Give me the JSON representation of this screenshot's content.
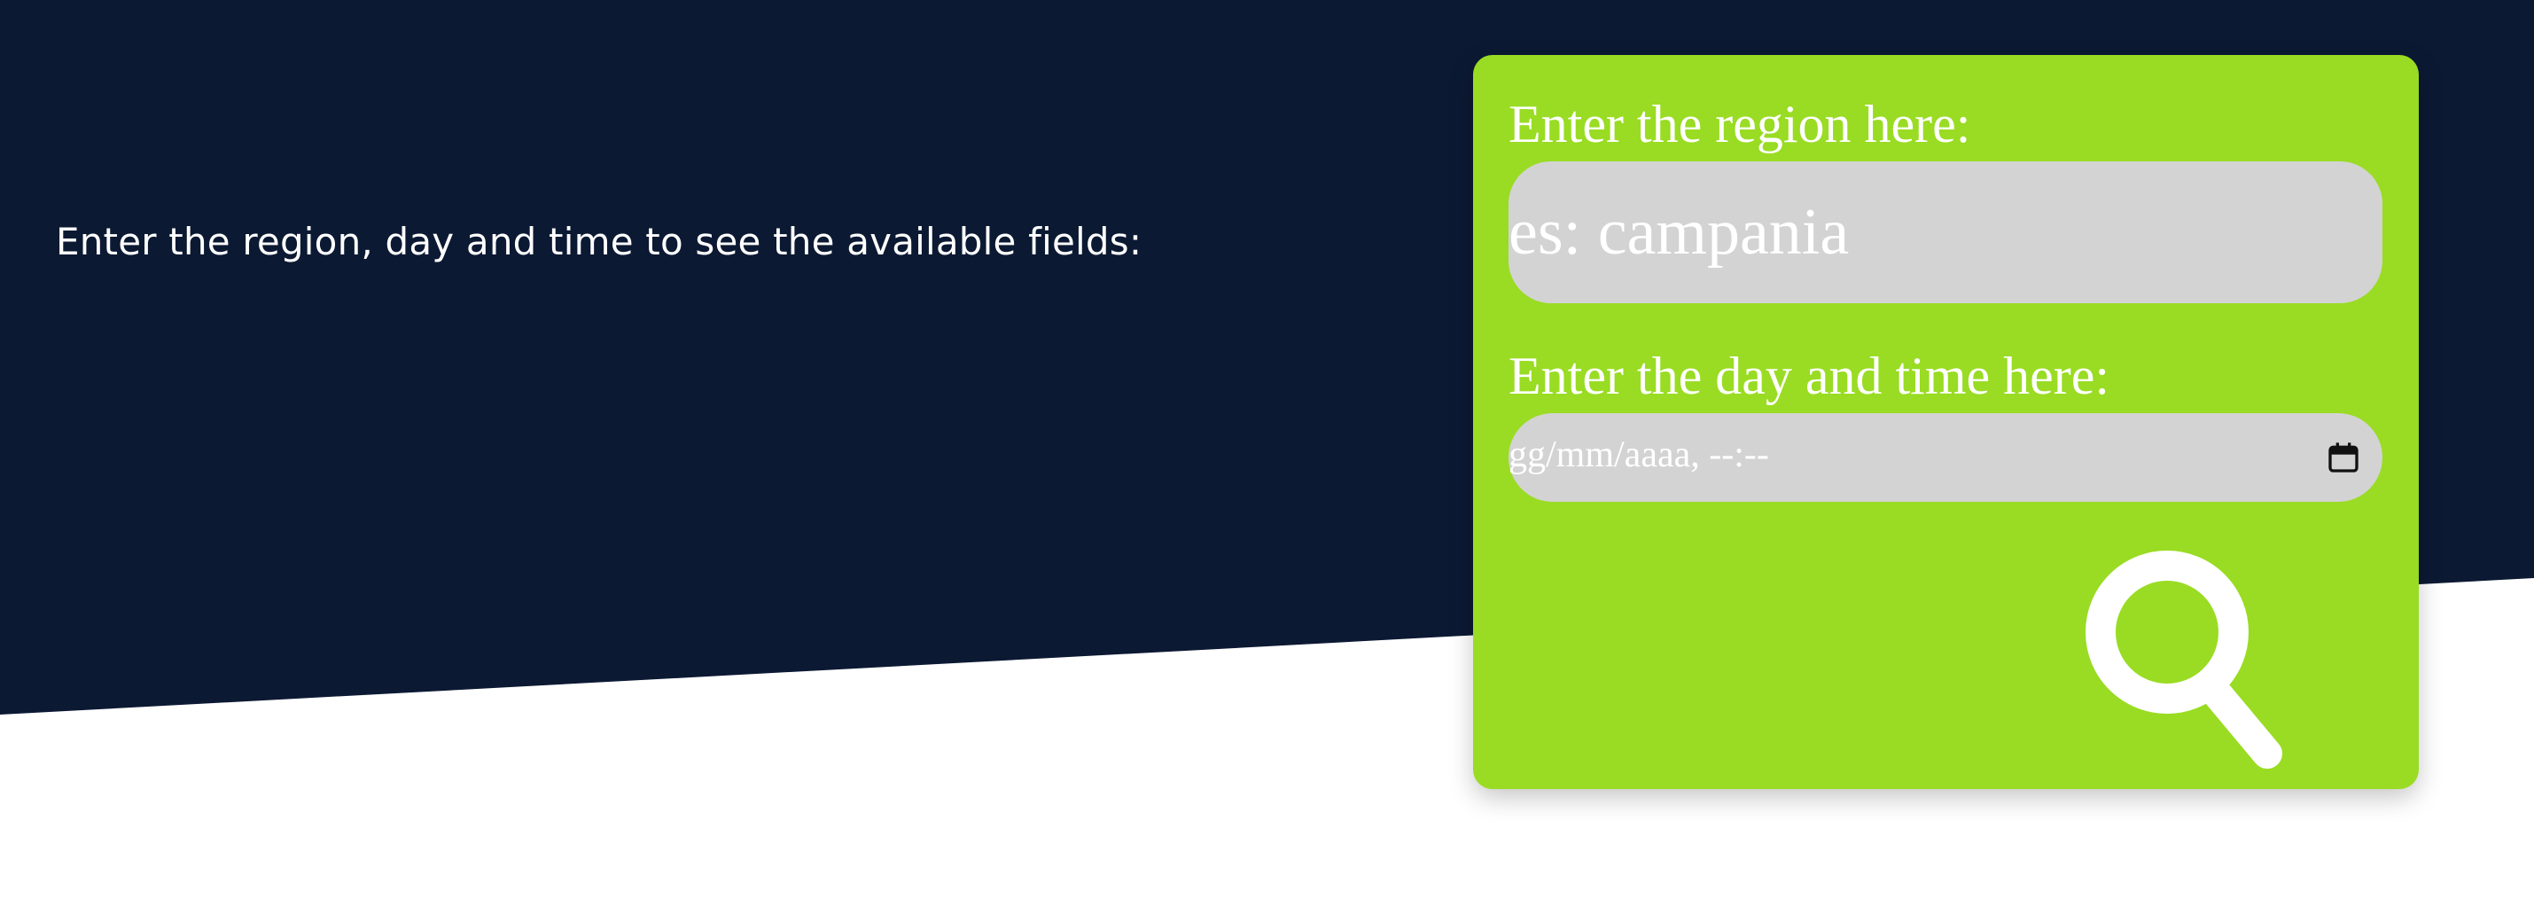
{
  "intro": {
    "text": "Enter the region, day and time to see the available fields:"
  },
  "search_form": {
    "region_label": "Enter the region here:",
    "region_placeholder": "es: campania",
    "datetime_label": "Enter the day and time here:",
    "datetime_placeholder": "gg/mm/aaaa, --:--",
    "calendar_icon": "calendar-icon",
    "search_icon": "search-icon"
  },
  "colors": {
    "header_background": "#0c1933",
    "card_background": "#99dc23",
    "input_background": "#d3d3d3",
    "text": "#ffffff"
  }
}
